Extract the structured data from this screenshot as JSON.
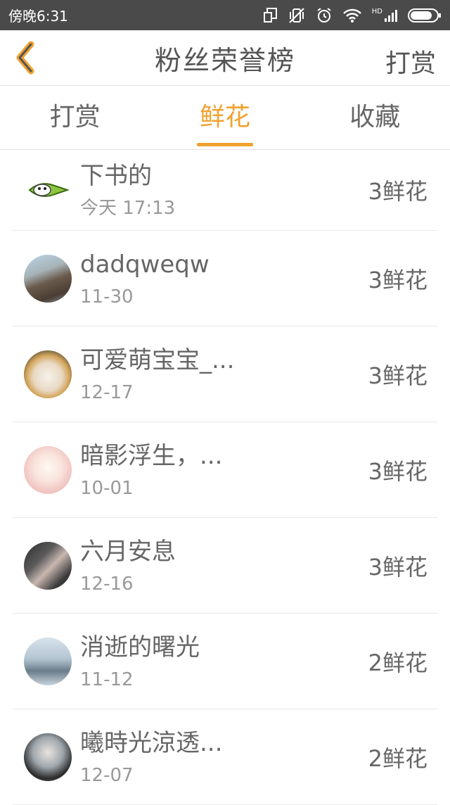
{
  "status_bar": {
    "time": "傍晚6:31",
    "network_label": "HD"
  },
  "header": {
    "title": "粉丝荣誉榜",
    "reward_label": "打赏"
  },
  "tabs": [
    {
      "label": "打赏"
    },
    {
      "label": "鲜花"
    },
    {
      "label": "收藏"
    }
  ],
  "active_tab": "鲜花",
  "accent_color": "#f0a22f",
  "list": [
    {
      "name": "下书的",
      "time": "今天 17:13",
      "count": "3鲜花"
    },
    {
      "name": "dadqweqw",
      "time": "11-30",
      "count": "3鲜花"
    },
    {
      "name": "可爱萌宝宝_...",
      "time": "12-17",
      "count": "3鲜花"
    },
    {
      "name": "暗影浮生，...",
      "time": "10-01",
      "count": "3鲜花"
    },
    {
      "name": "六月安息",
      "time": "12-16",
      "count": "3鲜花"
    },
    {
      "name": "消逝的曙光",
      "time": "11-12",
      "count": "2鲜花"
    },
    {
      "name": "曦時光涼透...",
      "time": "12-07",
      "count": "2鲜花"
    }
  ]
}
